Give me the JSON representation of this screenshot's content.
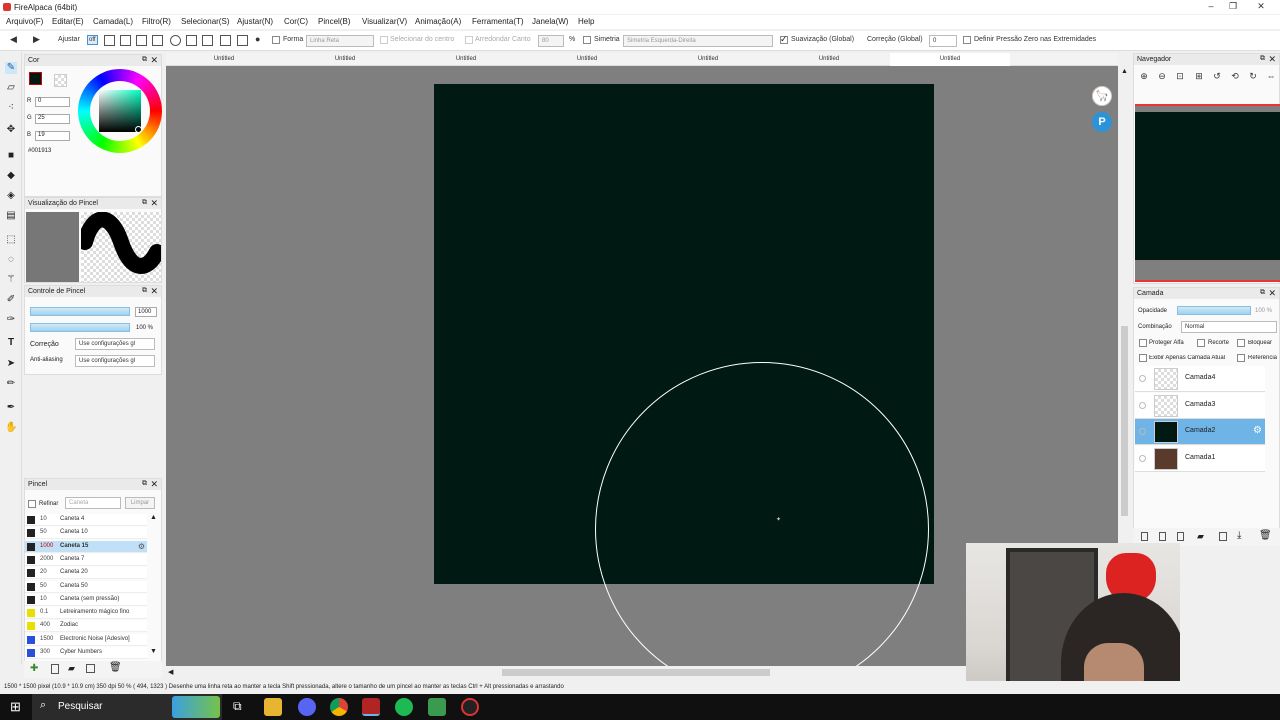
{
  "window": {
    "title": "FireAlpaca (64bit)"
  },
  "menu": [
    "Arquivo(F)",
    "Editar(E)",
    "Camada(L)",
    "Filtro(R)",
    "Selecionar(S)",
    "Ajustar(N)",
    "Cor(C)",
    "Pincel(B)",
    "Visualizar(V)",
    "Animação(A)",
    "Ferramenta(T)",
    "Janela(W)",
    "Help"
  ],
  "toolbar": {
    "adjust_label": "Ajustar",
    "off_label": "off",
    "shape_label": "Forma",
    "shape_value": "Linha Reta",
    "select_center": "Selecionar do centro",
    "round_corner": "Arredondar Canto",
    "round_value": "80",
    "percent": "%",
    "symmetry_label": "Simetria",
    "symmetry_value": "Simetria Esquerda-Direita",
    "smoothing_label": "Suavização (Global)",
    "correction_label": "Correção (Global)",
    "correction_value": "0",
    "pressure_label": "Definir Pressão Zero nas Extremidades"
  },
  "color_panel": {
    "title": "Cor",
    "r": "0",
    "g": "25",
    "b": "19",
    "r_label": "R",
    "g_label": "G",
    "b_label": "B",
    "hex": "#001913",
    "fg_color": "#001913"
  },
  "brush_preview": {
    "title": "Visualização do Pincel"
  },
  "brush_control": {
    "title": "Controle de Pincel",
    "size_value": "1000",
    "opacity_value": "100 %",
    "correction_label": "Correção",
    "correction_value": "Use configurações gl",
    "antialias_label": "Anti-aliasing",
    "antialias_value": "Use configurações gl"
  },
  "brush_panel": {
    "title": "Pincel",
    "refine_label": "Refinar",
    "filter_placeholder": "Caneta",
    "clear_label": "Limpar",
    "brushes": [
      {
        "size": "10",
        "name": "Caneta 4",
        "color": "#222222"
      },
      {
        "size": "50",
        "name": "Caneta 10",
        "color": "#222222"
      },
      {
        "size": "1000",
        "name": "Caneta 15",
        "color": "#222222",
        "selected": true
      },
      {
        "size": "2000",
        "name": "Caneta 7",
        "color": "#222222"
      },
      {
        "size": "20",
        "name": "Caneta 20",
        "color": "#222222"
      },
      {
        "size": "50",
        "name": "Caneta 50",
        "color": "#222222"
      },
      {
        "size": "10",
        "name": "Caneta (sem pressão)",
        "color": "#222222"
      },
      {
        "size": "0.1",
        "name": "Letreiramento mágico fino",
        "color": "#e8e000"
      },
      {
        "size": "400",
        "name": "Zodiac",
        "color": "#e8e000"
      },
      {
        "size": "1500",
        "name": "Electronic Noise [Adesivo]",
        "color": "#2a4fd8"
      },
      {
        "size": "300",
        "name": "Cyber Numbers",
        "color": "#2a4fd8"
      }
    ]
  },
  "tabs": [
    "Untitled",
    "Untitled",
    "Untitled",
    "Untitled",
    "Untitled",
    "Untitled",
    "Untitled"
  ],
  "navigator": {
    "title": "Navegador"
  },
  "layer_panel": {
    "title": "Camada",
    "opacity_label": "Opacidade",
    "opacity_value": "100 %",
    "blend_label": "Combinação",
    "blend_value": "Normal",
    "protect_alpha": "Proteger Alfa",
    "clipping": "Recorte",
    "lock": "Bloquear",
    "show_only": "Exibir Apenas Camada Atual",
    "reference": "Referência",
    "layers": [
      {
        "name": "Camada4",
        "thumb": "checker"
      },
      {
        "name": "Camada3",
        "thumb": "checker"
      },
      {
        "name": "Camada2",
        "thumb": "#001913",
        "selected": true
      },
      {
        "name": "Camada1",
        "thumb": "#5a3a2a"
      }
    ]
  },
  "status": {
    "text": "1500 * 1500 pixel  (10.9 * 10.9 cm)  350 dpi  50 %  ( 494, 1323 )  Desenhe uma linha reta ao manter a tecla Shift pressionada, altere o tamanho de um pincel ao manter as teclas Ctrl + Alt pressionadas e arrastando"
  },
  "taskbar": {
    "search_label": "Pesquisar"
  },
  "canvas": {
    "fill_color": "#001913",
    "background": "#7f7f7f"
  }
}
